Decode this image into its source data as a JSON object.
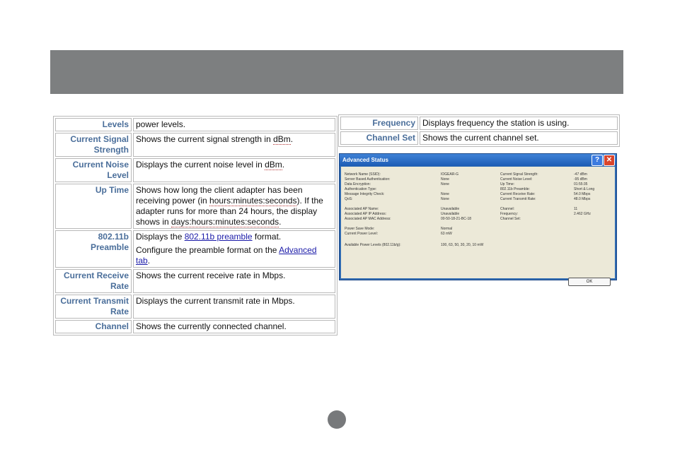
{
  "left_table": {
    "rows": [
      {
        "term": "Levels",
        "desc": "power levels."
      },
      {
        "term": "Current Signal Strength",
        "desc_pre": "Shows the current signal strength in ",
        "desc_sq": "dBm",
        "desc_post": "."
      },
      {
        "term": "Current Noise Level",
        "desc_pre": "Displays the current noise level in ",
        "desc_sq": "dBm",
        "desc_post": "."
      },
      {
        "term": "Up Time",
        "desc_pre": "Shows how long the client adapter has been receiving power (in ",
        "desc_sq": "hours:minutes:seconds",
        "desc_mid": "). If the adapter runs for more than 24 hours, the display shows in ",
        "desc_sq2": "days:hours:minutes:seconds",
        "desc_post": "."
      },
      {
        "term": "802.11b Preamble",
        "desc_pre": "Displays the ",
        "link1": "802.11b preamble",
        "desc_post": " format.",
        "desc2_pre": "Configure the preamble format on the ",
        "link2": "Advanced tab",
        "desc2_post": "."
      },
      {
        "term": "Current Receive Rate",
        "desc": "Shows the current receive rate in Mbps."
      },
      {
        "term": "Current Transmit Rate",
        "desc": "Displays the current transmit rate in Mbps."
      },
      {
        "term": "Channel",
        "desc": "Shows the currently connected channel."
      }
    ]
  },
  "right_table": {
    "rows": [
      {
        "term": "Frequency",
        "desc": "Displays frequency the station is using."
      },
      {
        "term": "Channel Set",
        "desc": "Shows the current channel set."
      }
    ]
  },
  "dialog": {
    "title": "Advanced Status",
    "help_glyph": "?",
    "close_glyph": "✕",
    "ok_label": "OK",
    "left_labels": [
      "Network Name (SSID):",
      "Server Based Authentication:",
      "Data Encryption:",
      "Authentication Type:",
      "Message Integrity Check:",
      "QoS:",
      "Associated AP Name:",
      "Associated AP IP Address:",
      "Associated AP MAC Address:",
      "Power Save Mode:",
      "Current Power Level:",
      "Available Power Levels (802.11b/g):"
    ],
    "left_values": [
      "IOGEAR-G",
      "None",
      "None",
      "",
      "None",
      "None",
      "Unavailable",
      "Unavailable",
      "00-50-18-21-BC-18",
      "Normal",
      "63 mW",
      "100, 63, 50, 30, 20, 10 mW"
    ],
    "right_labels": [
      "Current Signal Strength:",
      "Current Noise Level:",
      "Up Time:",
      "802.11b Preamble:",
      "Current Receive Rate:",
      "Current Transmit Rate:",
      "Channel:",
      "Frequency:",
      "Channel Set:"
    ],
    "right_values": [
      "-47 dBm",
      "-95 dBm",
      "01:55:35",
      "Short & Long",
      "54.0 Mbps",
      "48.0 Mbps",
      "11",
      "2.462 GHz",
      ""
    ]
  }
}
